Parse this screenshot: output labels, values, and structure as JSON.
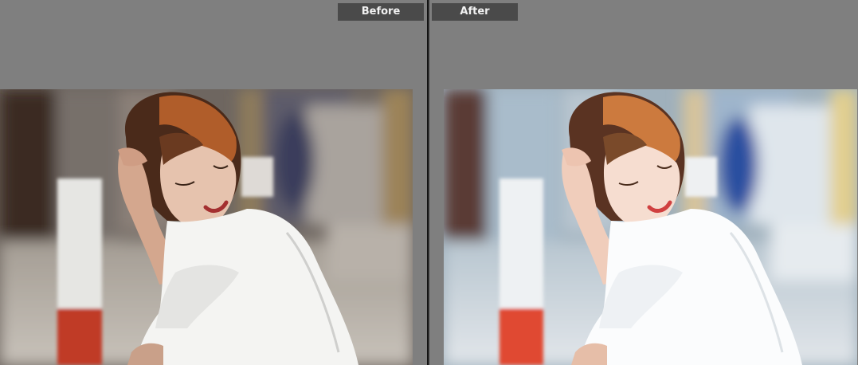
{
  "compare": {
    "before_label": "Before",
    "after_label": "After"
  },
  "colors": {
    "panel_bg": "#7f7f7f",
    "label_bg": "#4a4a4a",
    "divider": "#222222"
  }
}
